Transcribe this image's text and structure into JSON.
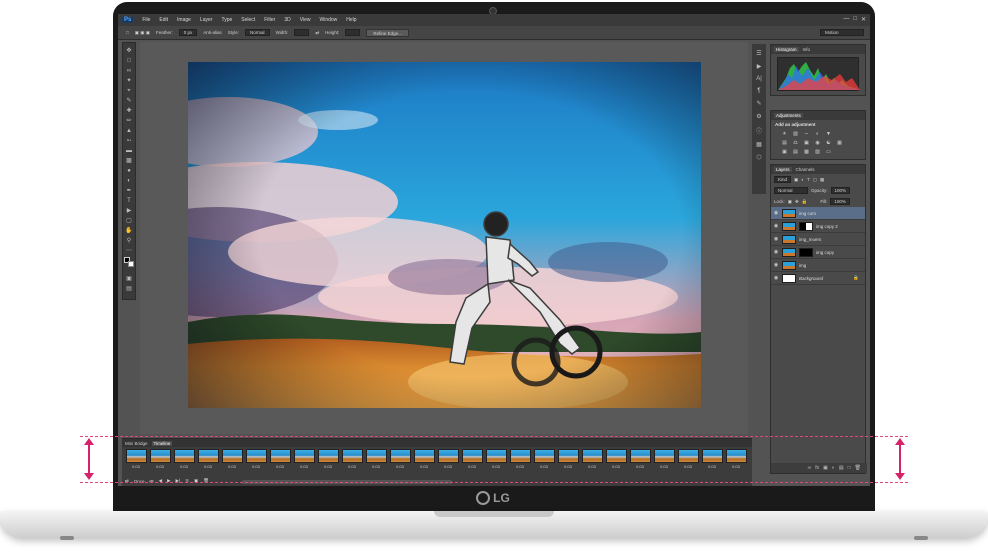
{
  "menu": {
    "app_icon": "Ps",
    "items": [
      "File",
      "Edit",
      "Image",
      "Layer",
      "Type",
      "Select",
      "Filter",
      "3D",
      "View",
      "Window",
      "Help"
    ]
  },
  "options": {
    "feather_label": "Feather:",
    "feather_value": "0 px",
    "antialias_label": "Anti-alias",
    "style_label": "Style:",
    "style_value": "Normal",
    "width_label": "Width:",
    "height_label": "Height:",
    "refine_button": "Refine Edge...",
    "workspace_value": "Motion"
  },
  "panels": {
    "histogram_tabs": [
      "Histogram",
      "Info"
    ],
    "adjustments_tab": "Adjustments",
    "adjustments_title": "Add an adjustment",
    "layers_tabs": [
      "Layers",
      "Channels"
    ],
    "kind_label": "Kind",
    "blend_mode": "Normal",
    "opacity_label": "Opacity:",
    "opacity_value": "100%",
    "lock_label": "Lock:",
    "fill_label": "Fill:",
    "fill_value": "100%",
    "layers": [
      {
        "name": "img com",
        "mask": false,
        "selected": true
      },
      {
        "name": "img copy 2",
        "mask": true,
        "selected": false
      },
      {
        "name": "img_moers",
        "mask": false,
        "selected": false
      },
      {
        "name": "img copy",
        "mask": true,
        "selected": false
      },
      {
        "name": "img",
        "mask": false,
        "selected": false
      },
      {
        "name": "Background",
        "mask": false,
        "selected": false
      }
    ]
  },
  "timeline": {
    "tabs": [
      "Mini Bridge",
      "Timeline"
    ],
    "frame_delay": "0.03",
    "frame_count": 26,
    "loop_value": "Once"
  },
  "brand": "LG",
  "colors": {
    "annotation": "#d4236a",
    "selected_layer": "#5a6e8a"
  }
}
